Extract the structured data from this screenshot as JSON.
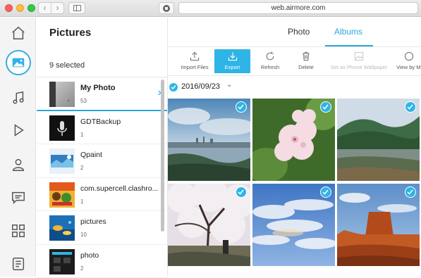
{
  "browser": {
    "url": "web.airmore.com"
  },
  "rail": {
    "items": [
      {
        "icon": "home-icon"
      },
      {
        "icon": "pictures-icon",
        "active": true
      },
      {
        "icon": "music-icon"
      },
      {
        "icon": "video-icon"
      },
      {
        "icon": "contacts-icon"
      },
      {
        "icon": "messages-icon"
      },
      {
        "icon": "apps-icon"
      },
      {
        "icon": "documents-icon"
      }
    ]
  },
  "list": {
    "title": "Pictures",
    "selected_text": "9 selected",
    "albums": [
      {
        "name": "My Photo",
        "count": "53"
      },
      {
        "name": "GDTBackup",
        "count": "1"
      },
      {
        "name": "Qpaint",
        "count": "2"
      },
      {
        "name": "com.supercell.clashro...",
        "count": "1"
      },
      {
        "name": "pictures",
        "count": "10"
      },
      {
        "name": "photo",
        "count": "2"
      }
    ]
  },
  "tabs": {
    "photo": "Photo",
    "albums": "Albums",
    "active": "Albums"
  },
  "toolbar": {
    "import": "Import Files",
    "export": "Export",
    "refresh": "Refresh",
    "delete": "Delete",
    "wallpaper": "Set as Phone Wallpaper",
    "view": "View by M"
  },
  "gallery": {
    "date": "2016/09/23",
    "selected_photos": 6
  },
  "colors": {
    "accent": "#2eb4e6",
    "tab_accent": "#2ca7dc"
  }
}
